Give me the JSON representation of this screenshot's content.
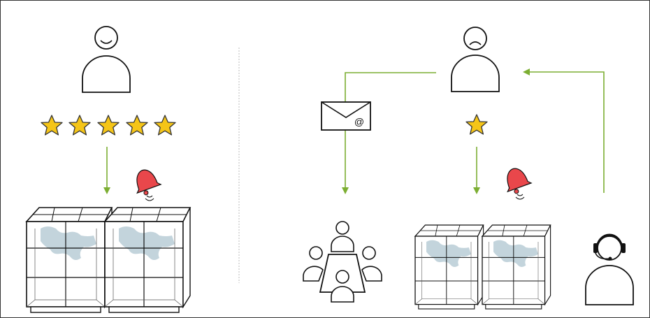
{
  "colors": {
    "arrow": "#7cae32",
    "star_fill": "#f5c518",
    "star_stroke": "#333333",
    "bell": "#e9474b",
    "outline": "#111111",
    "map": "#b9cdd6",
    "divider": "#bbbbbb"
  },
  "scenarios": [
    {
      "id": "satisfied",
      "customer_mood": "happy",
      "rating_stars": 5,
      "icons": [
        "happy-person-icon",
        "star-icon",
        "arrow-down-icon",
        "bell-icon",
        "display-case-icon"
      ]
    },
    {
      "id": "dissatisfied",
      "customer_mood": "sad",
      "rating_stars": 1,
      "icons": [
        "sad-person-icon",
        "envelope-icon",
        "meeting-table-icon",
        "star-icon",
        "bell-icon",
        "display-case-icon",
        "support-agent-icon"
      ]
    }
  ],
  "email_symbol": "@"
}
